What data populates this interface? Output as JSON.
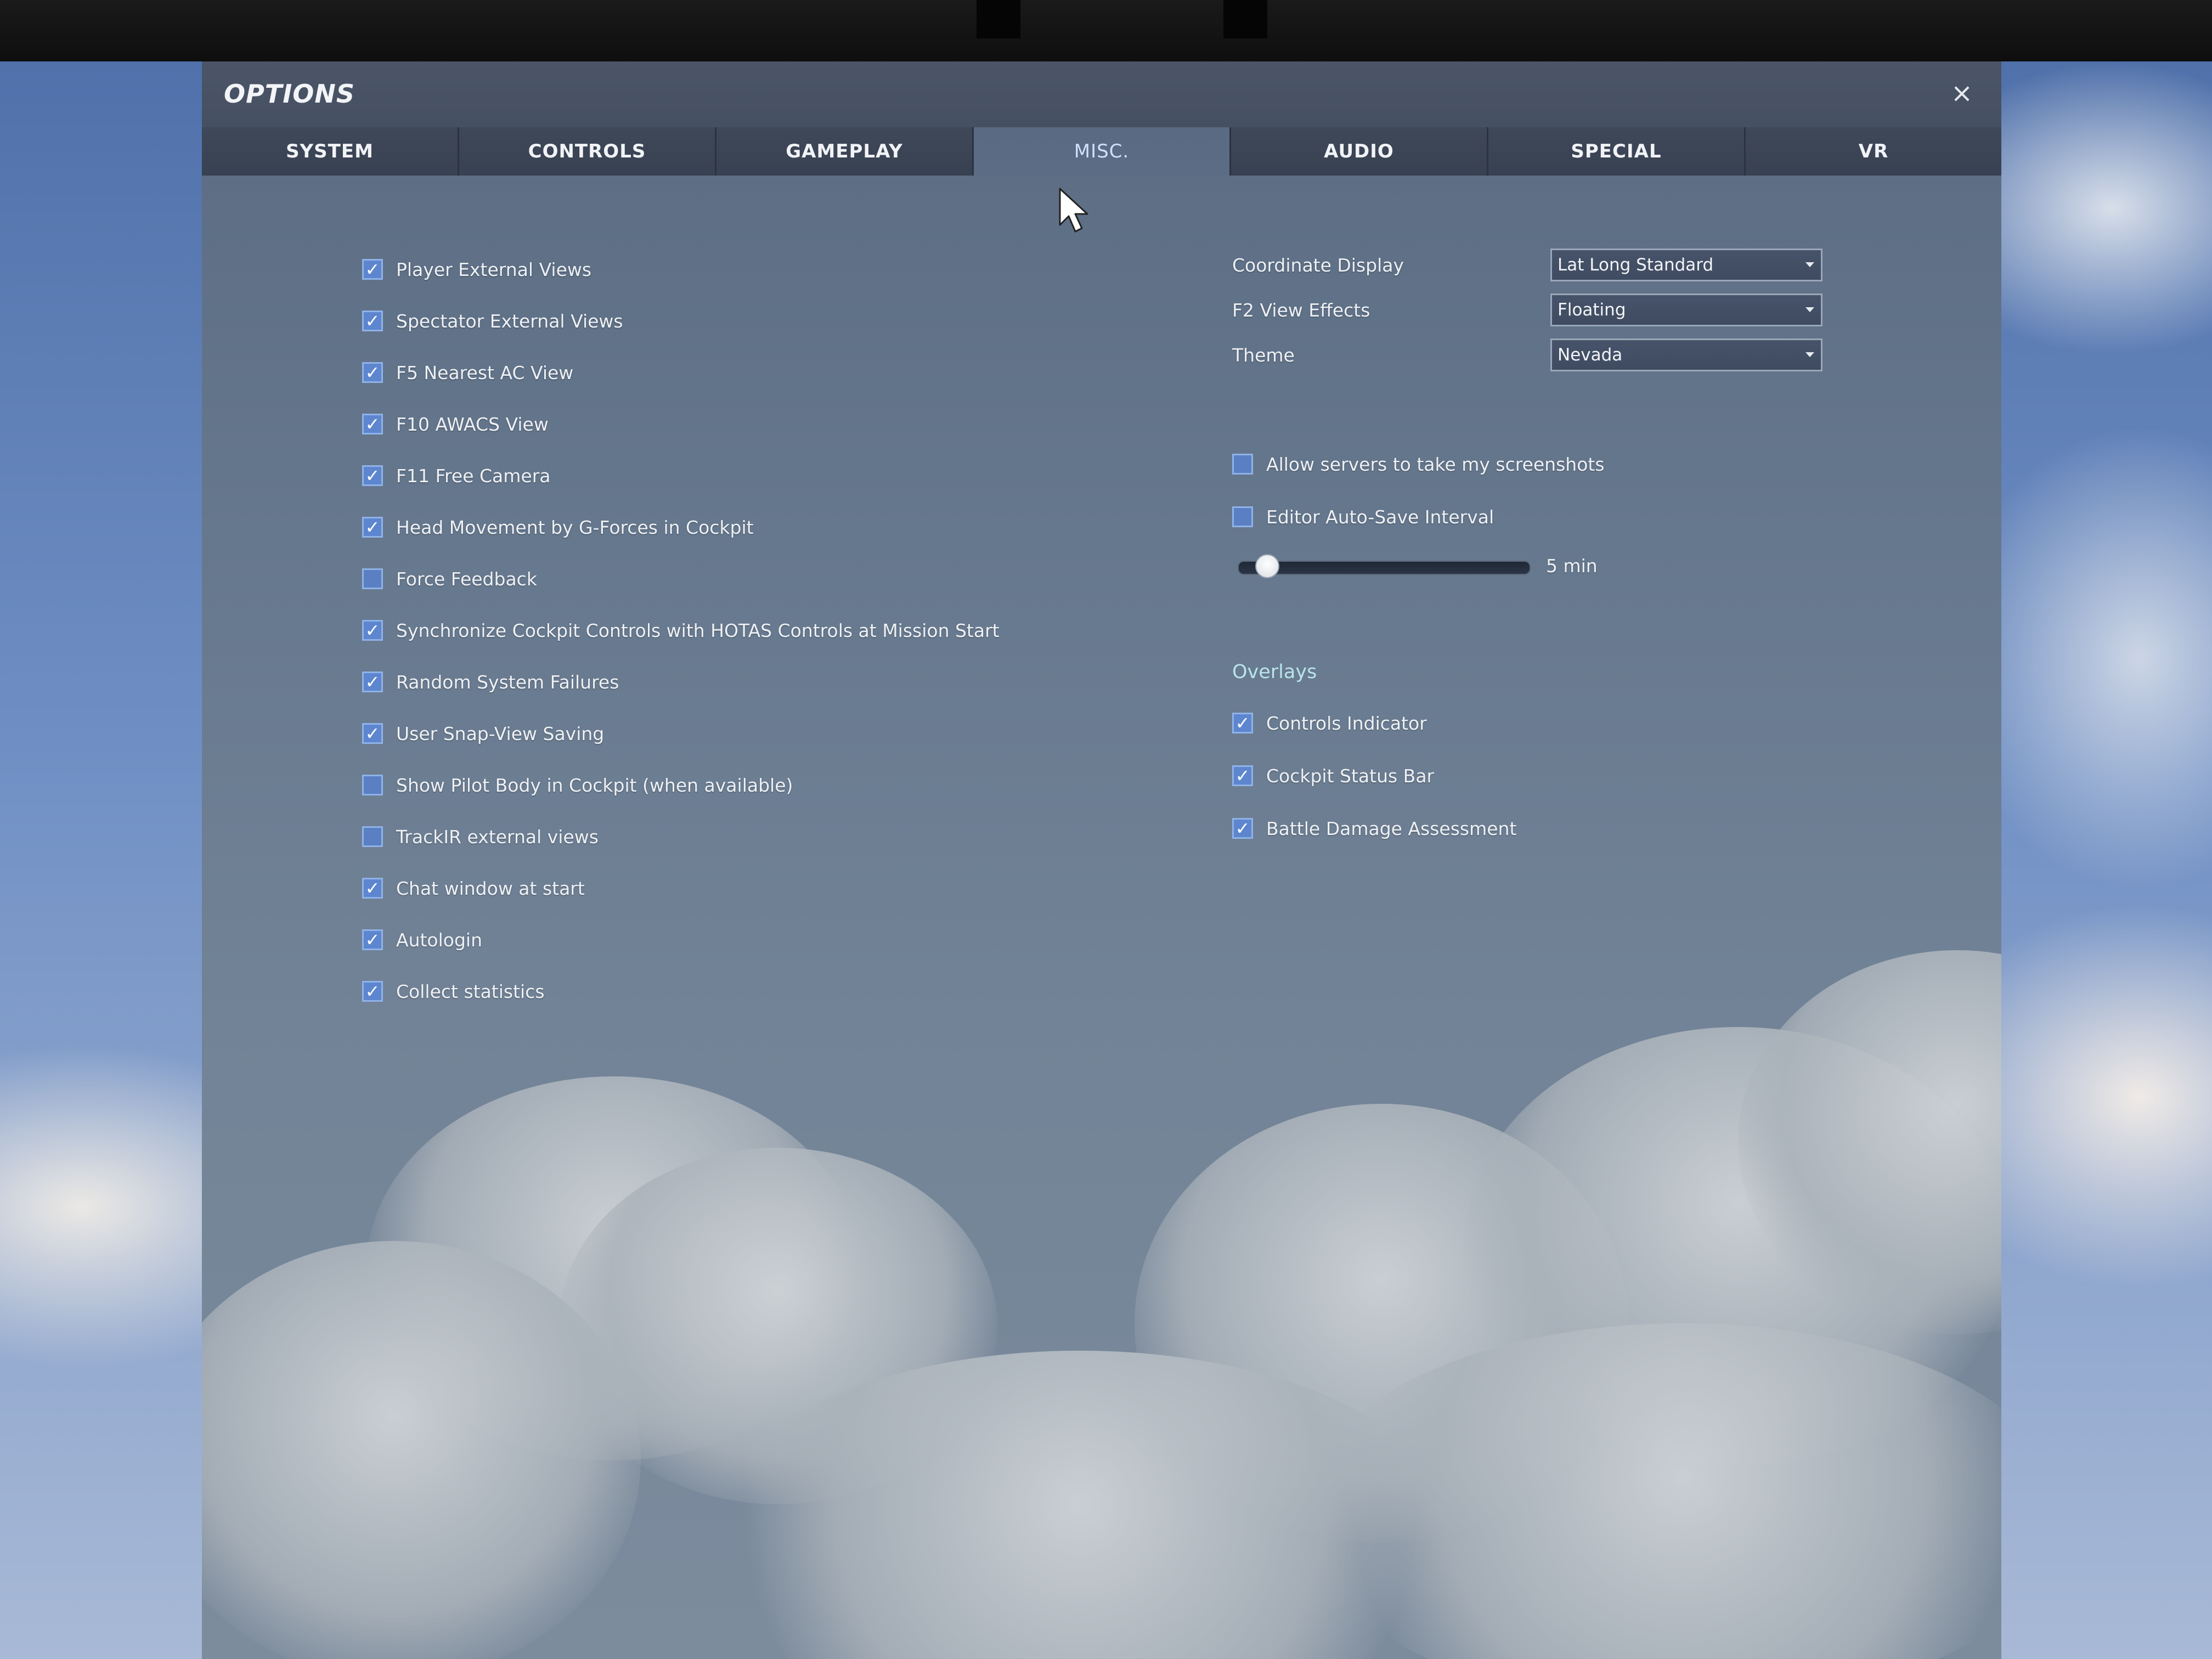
{
  "window": {
    "title": "OPTIONS",
    "close_label": "×"
  },
  "tabs": [
    {
      "label": "SYSTEM",
      "active": false
    },
    {
      "label": "CONTROLS",
      "active": false
    },
    {
      "label": "GAMEPLAY",
      "active": false
    },
    {
      "label": "MISC.",
      "active": true
    },
    {
      "label": "AUDIO",
      "active": false
    },
    {
      "label": "SPECIAL",
      "active": false
    },
    {
      "label": "VR",
      "active": false
    }
  ],
  "left_options": [
    {
      "label": "Player External Views",
      "checked": true
    },
    {
      "label": "Spectator External Views",
      "checked": true
    },
    {
      "label": "F5 Nearest AC View",
      "checked": true
    },
    {
      "label": "F10 AWACS View",
      "checked": true
    },
    {
      "label": "F11 Free Camera",
      "checked": true
    },
    {
      "label": "Head Movement by G-Forces in Cockpit",
      "checked": true
    },
    {
      "label": "Force Feedback",
      "checked": false
    },
    {
      "label": "Synchronize Cockpit Controls with HOTAS Controls at Mission Start",
      "checked": true
    },
    {
      "label": "Random System Failures",
      "checked": true
    },
    {
      "label": "User Snap-View Saving",
      "checked": true
    },
    {
      "label": "Show Pilot Body in Cockpit (when available)",
      "checked": false
    },
    {
      "label": "TrackIR external views",
      "checked": false
    },
    {
      "label": "Chat window at start",
      "checked": true
    },
    {
      "label": "Autologin",
      "checked": true
    },
    {
      "label": "Collect statistics",
      "checked": true
    }
  ],
  "dropdowns": [
    {
      "label": "Coordinate Display",
      "value": "Lat Long Standard"
    },
    {
      "label": "F2 View Effects",
      "value": "Floating"
    },
    {
      "label": "Theme",
      "value": "Nevada"
    }
  ],
  "right_options": [
    {
      "label": "Allow servers to take my screenshots",
      "checked": false
    },
    {
      "label": "Editor Auto-Save Interval",
      "checked": false
    }
  ],
  "autosave_slider": {
    "value_label": "5 min",
    "fraction": 0.05
  },
  "overlays": {
    "heading": "Overlays",
    "items": [
      {
        "label": "Controls Indicator",
        "checked": true
      },
      {
        "label": "Cockpit Status Bar",
        "checked": true
      },
      {
        "label": "Battle Damage Assessment",
        "checked": true
      }
    ]
  },
  "colors": {
    "checkbox_fill": "#5d86cf",
    "active_tab_text": "#cfe0ff",
    "overlays_heading": "#b9e3ea"
  }
}
